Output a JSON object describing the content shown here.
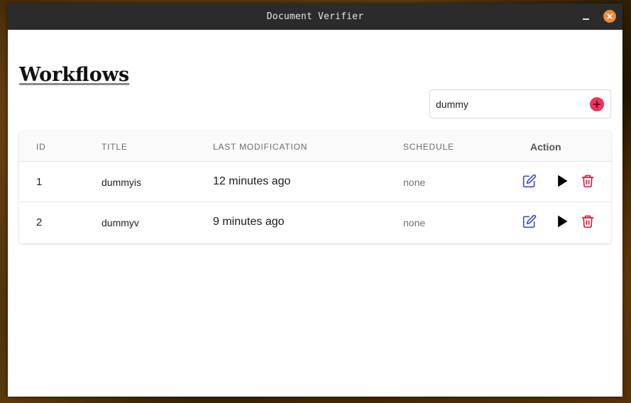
{
  "window": {
    "title": "Document Verifier"
  },
  "page": {
    "heading": "Workflows"
  },
  "search": {
    "value": "dummy"
  },
  "table": {
    "headers": {
      "id": "ID",
      "title": "TITLE",
      "last_modification": "LAST MODIFICATION",
      "schedule": "SCHEDULE",
      "action": "Action"
    },
    "rows": [
      {
        "id": "1",
        "title": "dummyis",
        "last_modification": "12 minutes ago",
        "schedule": "none"
      },
      {
        "id": "2",
        "title": "dummyv",
        "last_modification": "9 minutes ago",
        "schedule": "none"
      }
    ]
  },
  "icons": {
    "minimize": "minimize-icon",
    "close": "close-icon",
    "add": "plus-icon",
    "edit": "edit-icon",
    "run": "play-icon",
    "delete": "trash-icon"
  },
  "colors": {
    "titlebar": "#2b2b2b",
    "close_button": "#f0893a",
    "add_button": "#f0325d",
    "edit_icon": "#3a4fd8",
    "delete_icon": "#d81e3a"
  }
}
